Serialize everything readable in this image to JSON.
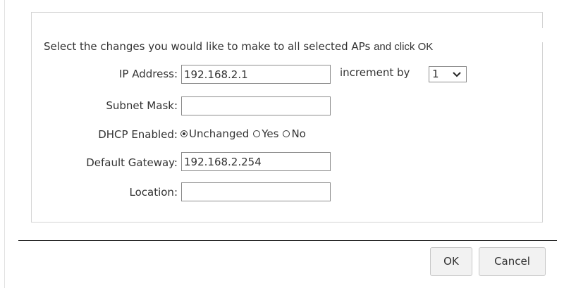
{
  "dialog": {
    "instructions": "Select the changes you would like to make to all selected APs",
    "instructions_tail": "and click OK"
  },
  "form": {
    "ip_address": {
      "label": "IP Address:",
      "value": "192.168.2.1",
      "increment_label": "increment by",
      "increment_value": "1"
    },
    "subnet_mask": {
      "label": "Subnet Mask:",
      "value": ""
    },
    "dhcp_enabled": {
      "label": "DHCP Enabled:",
      "options": [
        "Unchanged",
        "Yes",
        "No"
      ],
      "selected": "Unchanged"
    },
    "default_gateway": {
      "label": "Default Gateway:",
      "value": "192.168.2.254"
    },
    "location": {
      "label": "Location:",
      "value": ""
    }
  },
  "buttons": {
    "ok": "OK",
    "cancel": "Cancel"
  }
}
